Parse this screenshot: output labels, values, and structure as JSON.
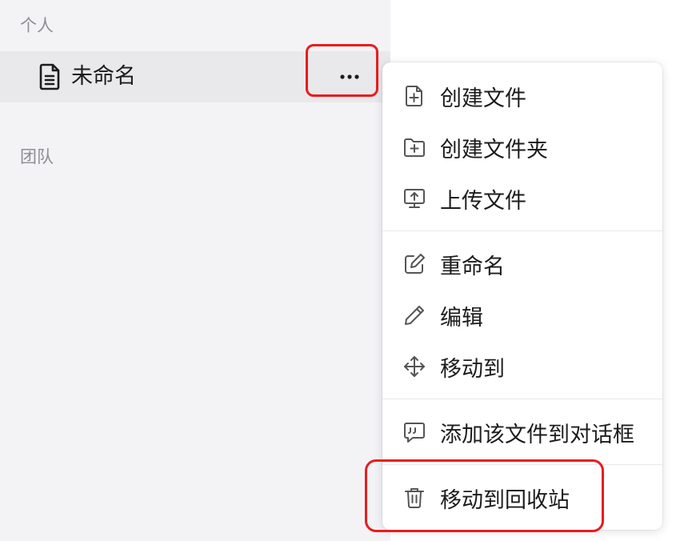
{
  "sidebar": {
    "section_personal": "个人",
    "section_team": "团队",
    "file": {
      "name": "未命名",
      "icon": "document-icon",
      "more_icon": "more-horizontal-icon"
    }
  },
  "context_menu": {
    "create_file": "创建文件",
    "create_folder": "创建文件夹",
    "upload_file": "上传文件",
    "rename": "重命名",
    "edit": "编辑",
    "move_to": "移动到",
    "add_to_chat": "添加该文件到对话框",
    "move_to_trash": "移动到回收站"
  },
  "colors": {
    "sidebar_bg": "#f3f3f6",
    "selected_row_bg": "#e9e9ec",
    "highlight_red": "#ea1c1c",
    "icon_gray": "#555555"
  }
}
